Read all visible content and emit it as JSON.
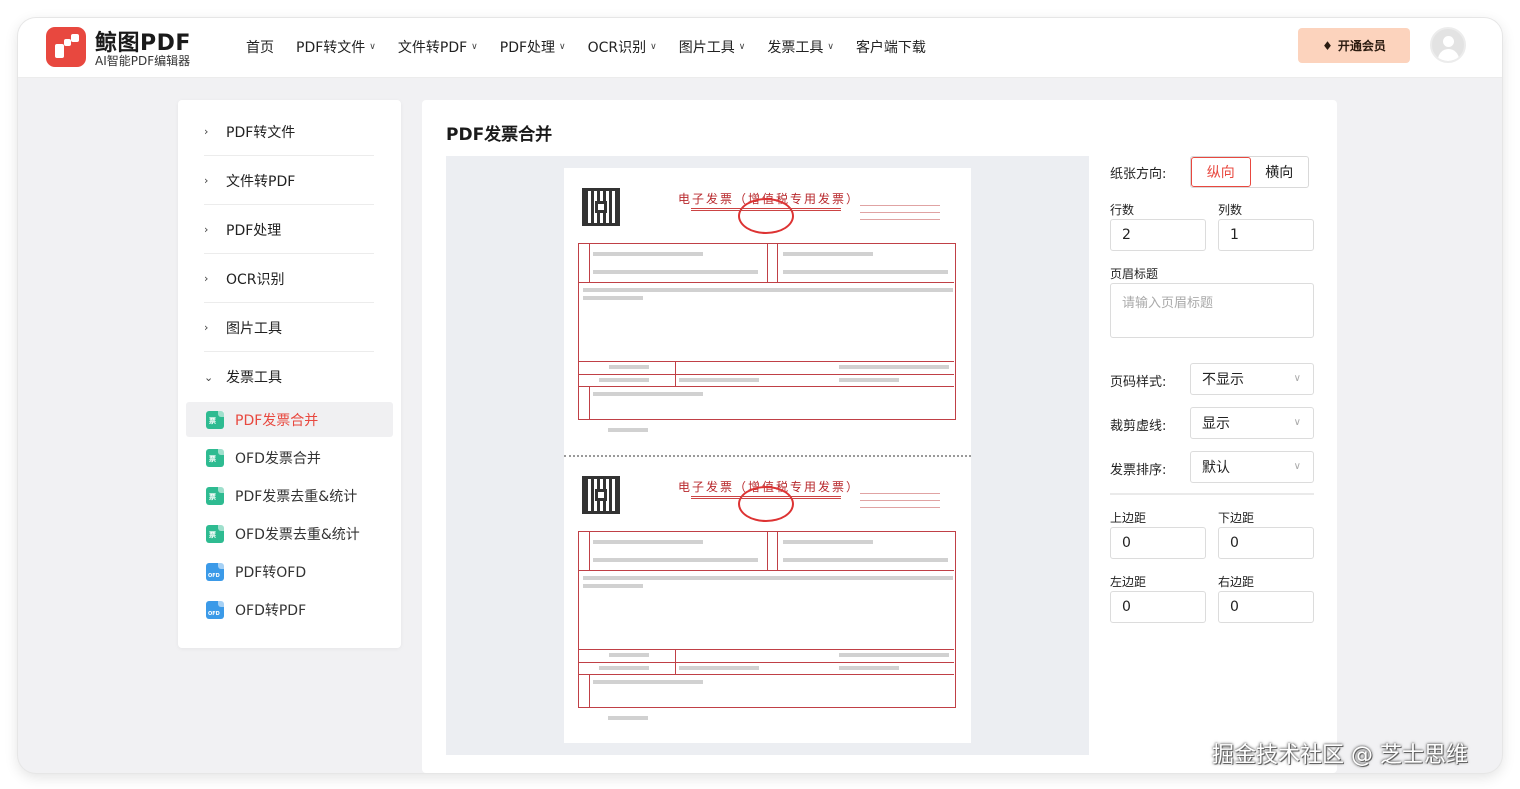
{
  "brand": {
    "name": "鲸图PDF",
    "tagline": "AI智能PDF编辑器",
    "color": "#e8483f"
  },
  "nav": {
    "items": [
      {
        "label": "首页",
        "has_dropdown": false
      },
      {
        "label": "PDF转文件",
        "has_dropdown": true
      },
      {
        "label": "文件转PDF",
        "has_dropdown": true
      },
      {
        "label": "PDF处理",
        "has_dropdown": true
      },
      {
        "label": "OCR识别",
        "has_dropdown": true
      },
      {
        "label": "图片工具",
        "has_dropdown": true
      },
      {
        "label": "发票工具",
        "has_dropdown": true
      },
      {
        "label": "客户端下载",
        "has_dropdown": false
      }
    ],
    "vip_label": "开通会员",
    "vip_color": "#fcd3bd"
  },
  "sidebar": {
    "groups": [
      {
        "label": "PDF转文件",
        "expanded": false
      },
      {
        "label": "文件转PDF",
        "expanded": false
      },
      {
        "label": "PDF处理",
        "expanded": false
      },
      {
        "label": "OCR识别",
        "expanded": false
      },
      {
        "label": "图片工具",
        "expanded": false
      },
      {
        "label": "发票工具",
        "expanded": true
      }
    ],
    "invoice_tools": [
      {
        "label": "PDF发票合并",
        "active": true,
        "icon": "green-invoice-file-icon"
      },
      {
        "label": "OFD发票合并",
        "active": false,
        "icon": "green-invoice-file-icon"
      },
      {
        "label": "PDF发票去重&统计",
        "active": false,
        "icon": "green-invoice-file-icon"
      },
      {
        "label": "OFD发票去重&统计",
        "active": false,
        "icon": "green-invoice-file-icon"
      },
      {
        "label": "PDF转OFD",
        "active": false,
        "icon": "blue-ofd-file-icon"
      },
      {
        "label": "OFD转PDF",
        "active": false,
        "icon": "blue-ofd-file-icon"
      }
    ]
  },
  "main": {
    "title": "PDF发票合并",
    "preview": {
      "invoice_title": "电子发票（增值税专用发票）",
      "invoices_per_page": 2
    }
  },
  "settings": {
    "orientation_label": "纸张方向:",
    "orientation_options": [
      "纵向",
      "横向"
    ],
    "orientation_selected": "纵向",
    "rows_label": "行数",
    "rows_value": "2",
    "cols_label": "列数",
    "cols_value": "1",
    "header_title_label": "页眉标题",
    "header_title_placeholder": "请输入页眉标题",
    "page_number_label": "页码样式:",
    "page_number_value": "不显示",
    "cut_line_label": "裁剪虚线:",
    "cut_line_value": "显示",
    "sort_label": "发票排序:",
    "sort_value": "默认",
    "margin_top_label": "上边距",
    "margin_top_value": "0",
    "margin_bottom_label": "下边距",
    "margin_bottom_value": "0",
    "margin_left_label": "左边距",
    "margin_left_value": "0",
    "margin_right_label": "右边距",
    "margin_right_value": "0"
  },
  "watermark": "掘金技术社区 @ 芝士思维"
}
